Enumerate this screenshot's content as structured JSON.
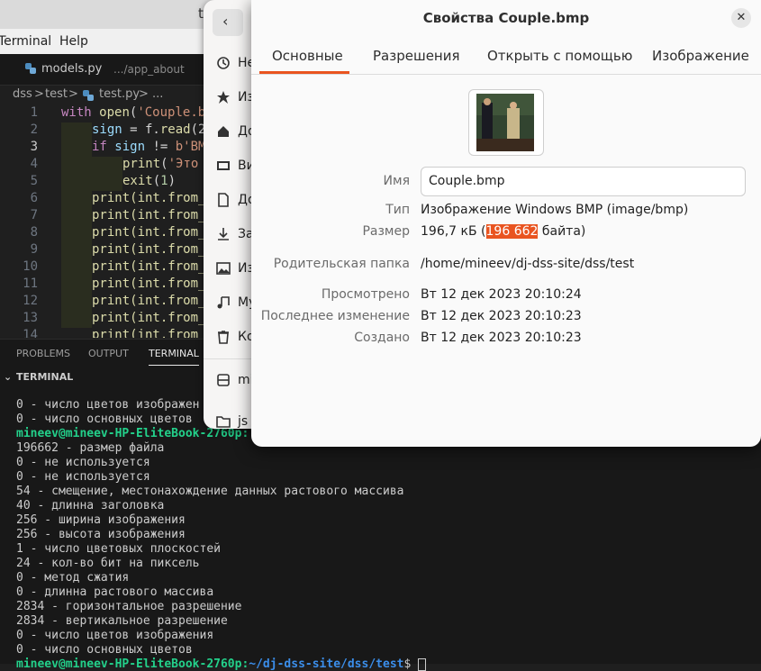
{
  "vscode": {
    "title_fragment": "t",
    "menu": [
      "Terminal",
      "Help"
    ],
    "tab": {
      "name": "models.py",
      "path": ".../app_about"
    },
    "breadcrumb": [
      "dss",
      ">",
      "test",
      ">",
      "test.py",
      "> ..."
    ],
    "code_lines": [
      {
        "n": "1"
      },
      {
        "n": "2"
      },
      {
        "n": "3"
      },
      {
        "n": "4"
      },
      {
        "n": "5"
      },
      {
        "n": "6"
      },
      {
        "n": "7"
      },
      {
        "n": "8"
      },
      {
        "n": "9"
      },
      {
        "n": "10"
      },
      {
        "n": "11"
      },
      {
        "n": "12"
      },
      {
        "n": "13"
      },
      {
        "n": "14"
      }
    ],
    "code_text": {
      "l1_a": "with ",
      "l1_b": "open",
      "l1_c": "(",
      "l1_d": "'Couple.b",
      "l2_a": "sign",
      "l2_b": " = f.",
      "l2_c": "read",
      "l2_d": "(2",
      "l3_a": "if ",
      "l3_b": "sign",
      "l3_c": " != ",
      "l3_d": "b'BM",
      "l4_a": "print",
      "l4_b": "(",
      "l4_c": "'Это",
      "l5_a": "exit",
      "l5_b": "(",
      "l5_c": "1",
      "l5_d": ")",
      "print_from": "print(int.from_"
    },
    "panel_tabs": [
      "PROBLEMS",
      "OUTPUT",
      "TERMINAL"
    ],
    "terminal_header": "TERMINAL",
    "terminal_lines": [
      "0 - число цветов изображен",
      "0 - число основных цветов",
      "",
      "196662 - размер файла",
      "0 - не используется",
      "0 - не используется",
      "54 - смещение, местонахождение данных растового массива",
      "40 - длинна заголовка",
      "256 - ширина изображения",
      "256 - высота изображения",
      "1 - число цветовых плоскостей",
      "24 - кол-во бит на пиксель",
      "0 - метод сжатия",
      "0 - длинна растового массива",
      "2834 - горизонтальное разрешение",
      "2834 - вертикальное разрешение",
      "0 - число цветов изображения",
      "0 - число основных цветов"
    ],
    "prompt_top": "mineev@mineev-HP-EliteBook-2760p:",
    "prompt_bottom_user": "mineev@mineev-HP-EliteBook-2760p:",
    "prompt_bottom_path": "~/dj-dss-site/dss/test",
    "prompt_bottom_suffix": "$ "
  },
  "files": {
    "items": [
      {
        "label": "Не",
        "icon": "recent-icon"
      },
      {
        "label": "Из",
        "icon": "star-icon"
      },
      {
        "label": "До",
        "icon": "home-icon"
      },
      {
        "label": "Ви",
        "icon": "video-icon"
      },
      {
        "label": "До",
        "icon": "document-icon"
      },
      {
        "label": "За",
        "icon": "download-icon"
      },
      {
        "label": "Из",
        "icon": "image-icon"
      },
      {
        "label": "Му",
        "icon": "music-icon"
      },
      {
        "label": "Ко",
        "icon": "trash-icon"
      },
      {
        "label": "mi",
        "icon": "drive-icon"
      },
      {
        "label": "js",
        "icon": "folder-icon"
      }
    ]
  },
  "dialog": {
    "title": "Свойства Couple.bmp",
    "tabs": [
      "Основные",
      "Разрешения",
      "Открыть с помощью",
      "Изображение"
    ],
    "active_tab": 0,
    "accent": "#e95420",
    "labels": {
      "name": "Имя",
      "type": "Тип",
      "size": "Размер",
      "parent": "Родительская папка",
      "accessed": "Просмотрено",
      "modified": "Последнее изменение",
      "created": "Создано"
    },
    "values": {
      "name": "Couple.bmp",
      "type": "Изображение Windows BMP (image/bmp)",
      "size_prefix": "196,7 кБ (",
      "size_bytes": "196 662",
      "size_suffix": " байта)",
      "parent": "/home/mineev/dj-dss-site/dss/test",
      "accessed": "Вт 12 дек 2023 20:10:24",
      "modified": "Вт 12 дек 2023 20:10:23",
      "created": "Вт 12 дек 2023 20:10:23"
    }
  }
}
